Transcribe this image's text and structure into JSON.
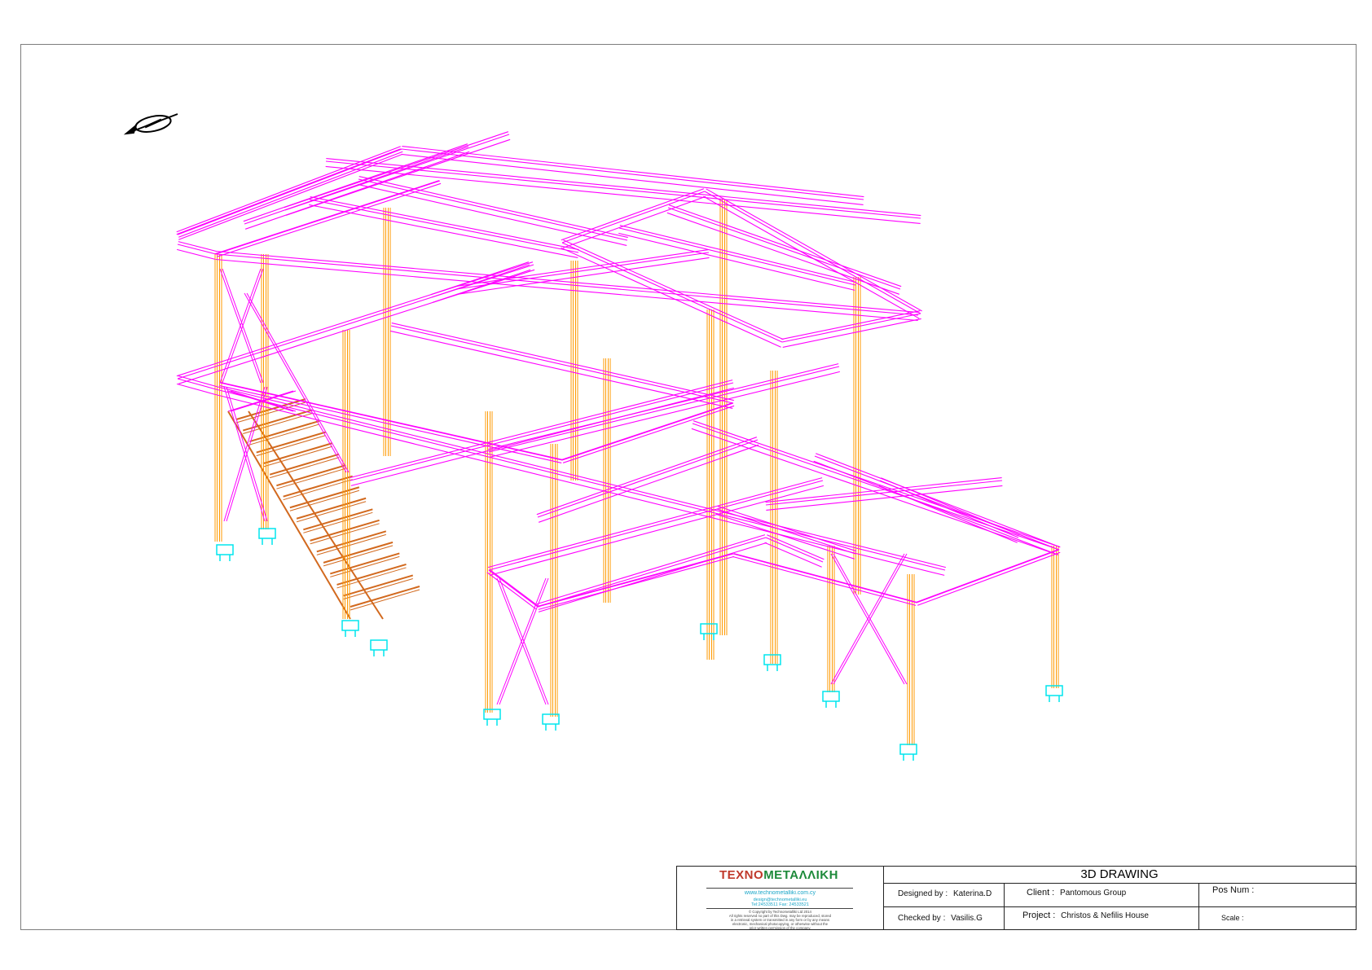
{
  "drawing": {
    "title": "3D DRAWING",
    "colors": {
      "beam": "#ff00ff",
      "column": "#ff9a00",
      "plate": "#00e5ee",
      "stair": "#d2691e",
      "frame": "#7d7d7d"
    }
  },
  "title_block": {
    "logo": {
      "part1": "TEXNO",
      "part2": "METAΛΛIKH"
    },
    "website": "www.technometalliki.com.cy",
    "email": "design@technometalliki.eu",
    "phone": "Tel:24533511   Fax: 24533521",
    "copyright": "© Copyright by Technometalliki Ltd 2014",
    "rights_1": "All rights reserved no part of this Dwg. may be reproduced, stored",
    "rights_2": "in a retrieval system or transmitted in any form or by any means",
    "rights_3": "electronic, mechanical photocopying, or otherwise without the",
    "rights_4": "prior written permission of the company.",
    "designed_by_label": "Designed by :",
    "designed_by": "Katerina.D",
    "checked_by_label": "Checked by :",
    "checked_by": "Vasilis.G",
    "client_label": "Client :",
    "client": "Pantomous Group",
    "project_label": "Project :",
    "project": "Christos & Nefilis House",
    "pos_num_label": "Pos Num :",
    "scale_label": "Scale :"
  }
}
